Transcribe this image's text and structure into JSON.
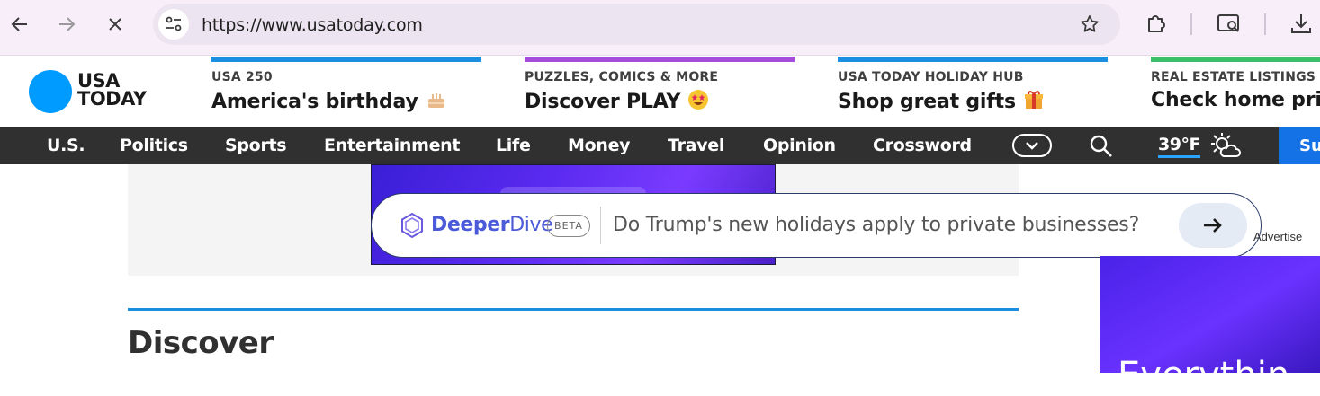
{
  "browser": {
    "url": "https://www.usatoday.com",
    "icons": [
      "back-arrow-icon",
      "forward-arrow-icon",
      "stop-loading-icon",
      "site-info-icon",
      "bookmark-star-icon",
      "extensions-icon",
      "screen-search-icon",
      "download-icon"
    ]
  },
  "logo": {
    "line1": "USA",
    "line2": "TODAY",
    "color": "#009bff"
  },
  "promos": [
    {
      "kicker": "USA 250",
      "headline": "America's birthday",
      "bar_color": "#1a8fe0",
      "emoji": "birthday-cake"
    },
    {
      "kicker": "PUZZLES, COMICS & MORE",
      "headline": "Discover PLAY",
      "bar_color": "#a64cdc",
      "emoji": "star-struck-face"
    },
    {
      "kicker": "USA TODAY HOLIDAY HUB",
      "headline": "Shop great gifts",
      "bar_color": "#1a8fe0",
      "emoji": "wrapped-gift"
    },
    {
      "kicker": "REAL ESTATE LISTINGS",
      "headline": "Check home pric",
      "bar_color": "#3cbf6a",
      "emoji": ""
    }
  ],
  "nav": {
    "items": [
      "U.S.",
      "Politics",
      "Sports",
      "Entertainment",
      "Life",
      "Money",
      "Travel",
      "Opinion",
      "Crossword"
    ],
    "temperature": "39°F",
    "subscribe": "Su"
  },
  "deeperdive": {
    "brand_a": "Deeper",
    "brand_b": "Dive",
    "badge": "BETA",
    "placeholder": "Do Trump's new holidays apply to private businesses?"
  },
  "right_ad": {
    "label": "Advertise",
    "text": "Everythin"
  },
  "section": {
    "title": "Discover"
  }
}
